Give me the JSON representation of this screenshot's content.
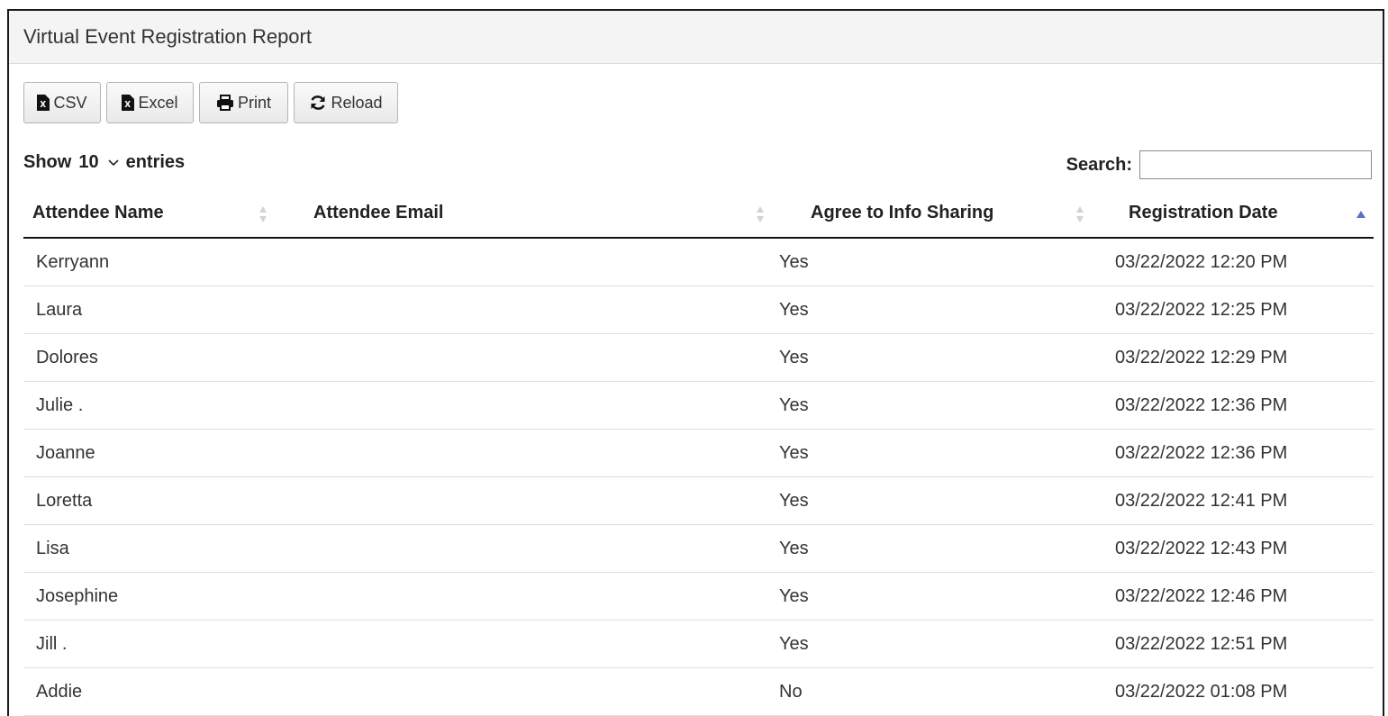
{
  "report": {
    "title": "Virtual Event Registration Report"
  },
  "toolbar": {
    "buttons": [
      {
        "label": "CSV",
        "icon": "file-excel-icon"
      },
      {
        "label": "Excel",
        "icon": "file-excel-icon"
      },
      {
        "label": "Print",
        "icon": "print-icon"
      },
      {
        "label": "Reload",
        "icon": "refresh-icon"
      }
    ]
  },
  "length": {
    "prefix": "Show",
    "value": "10",
    "suffix": "entries"
  },
  "search": {
    "label": "Search:",
    "value": ""
  },
  "table": {
    "columns": [
      {
        "label": "Attendee Name",
        "sort": "none"
      },
      {
        "label": "Attendee Email",
        "sort": "none"
      },
      {
        "label": "Agree to Info Sharing",
        "sort": "none"
      },
      {
        "label": "Registration Date",
        "sort": "ascending"
      }
    ],
    "rows": [
      {
        "name": "Kerryann",
        "agree": "Yes",
        "date": "03/22/2022 12:20 PM"
      },
      {
        "name": "Laura",
        "agree": "Yes",
        "date": "03/22/2022 12:25 PM"
      },
      {
        "name": "Dolores",
        "agree": "Yes",
        "date": "03/22/2022 12:29 PM"
      },
      {
        "name": "Julie .",
        "agree": "Yes",
        "date": "03/22/2022 12:36 PM"
      },
      {
        "name": "Joanne",
        "agree": "Yes",
        "date": "03/22/2022 12:36 PM"
      },
      {
        "name": "Loretta",
        "agree": "Yes",
        "date": "03/22/2022 12:41 PM"
      },
      {
        "name": "Lisa",
        "agree": "Yes",
        "date": "03/22/2022 12:43 PM"
      },
      {
        "name": "Josephine",
        "agree": "Yes",
        "date": "03/22/2022 12:46 PM"
      },
      {
        "name": "Jill .",
        "agree": "Yes",
        "date": "03/22/2022 12:51 PM"
      },
      {
        "name": "Addie",
        "agree": "No",
        "date": "03/22/2022 01:08 PM"
      }
    ]
  },
  "colors": {
    "sort_active": "#5b6fc4",
    "sort_inactive": "#d3d3d3",
    "email_redacted": "#c9c9c9"
  }
}
